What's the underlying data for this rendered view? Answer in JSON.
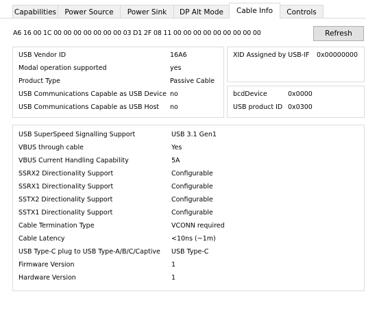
{
  "tabs": [
    "Capabilities",
    "Power Source",
    "Power Sink",
    "DP Alt Mode",
    "Cable Info",
    "Controls"
  ],
  "hex_line": "A6 16 00 1C 00 00 00 00 00 00 00 03 D1 2F 08 11 00 00 00 00 00 00 00 00 00",
  "refresh_label": "Refresh",
  "identity": [
    {
      "label": "USB Vendor ID",
      "value": "16A6"
    },
    {
      "label": "Modal operation supported",
      "value": "yes"
    },
    {
      "label": "Product Type",
      "value": "Passive Cable"
    },
    {
      "label": "USB Communications Capable as USB Device",
      "value": "no"
    },
    {
      "label": "USB Communications Capable as USB Host",
      "value": "no"
    }
  ],
  "xid": {
    "label": "XID Assigned by USB-IF",
    "value": "0x00000000"
  },
  "product": [
    {
      "label": "bcdDevice",
      "value": "0x0000"
    },
    {
      "label": "USB product ID",
      "value": "0x0300"
    }
  ],
  "cable": [
    {
      "label": "USB SuperSpeed Signalling Support",
      "value": "USB 3.1 Gen1"
    },
    {
      "label": "VBUS through cable",
      "value": "Yes"
    },
    {
      "label": "VBUS Current Handling Capability",
      "value": "5A"
    },
    {
      "label": "SSRX2 Directionality Support",
      "value": "Configurable"
    },
    {
      "label": "SSRX1 Directionality Support",
      "value": "Configurable"
    },
    {
      "label": "SSTX2 Directionality Support",
      "value": "Configurable"
    },
    {
      "label": "SSTX1 Directionality Support",
      "value": "Configurable"
    },
    {
      "label": "Cable Termination Type",
      "value": "VCONN required"
    },
    {
      "label": "Cable Latency",
      "value": "<10ns (~1m)"
    },
    {
      "label": "USB Type-C plug to USB Type-A/B/C/Captive",
      "value": "USB Type-C"
    },
    {
      "label": "Firmware Version",
      "value": "1"
    },
    {
      "label": "Hardware Version",
      "value": "1"
    }
  ]
}
